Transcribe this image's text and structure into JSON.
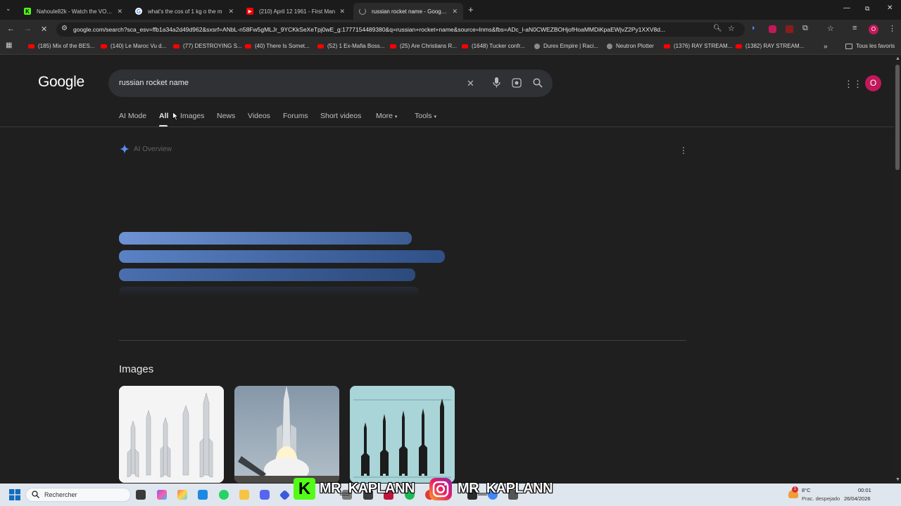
{
  "browser": {
    "tabs": [
      {
        "title": "Nahoule82k - Watch the VOD o",
        "favicon": "kick-icon",
        "color": "#53fc18"
      },
      {
        "title": "what's the cos of 1 kg o the m",
        "favicon": "google-icon",
        "color": "#4285f4"
      },
      {
        "title": "(210) April 12 1961 - First Man",
        "favicon": "youtube-icon",
        "color": "#ff0000"
      },
      {
        "title": "russian rocket name - Google S",
        "favicon": "loading-icon",
        "color": "#9aa0a6",
        "active": true
      }
    ],
    "url": "google.com/search?sca_esv=ffb1a34a2d49d962&sxsrf=ANbL-n58Fw5gMLJr_9YCKkSeXeTpj0wE_g:1777154489380&q=russian+rocket+name&source=lnms&fbs=ADc_l-aN0CWEZBOHjofHoaMMDiKpaEWjvZ2Py1XXV8d...",
    "bookmarks": [
      {
        "label": "(185) Mix of the BES...",
        "type": "yt"
      },
      {
        "label": "(140) Le Maroc Vu d...",
        "type": "yt"
      },
      {
        "label": "(77) DESTROYING S...",
        "type": "yt"
      },
      {
        "label": "(40) There Is Somet...",
        "type": "yt"
      },
      {
        "label": "(52) 1 Ex-Mafia Boss...",
        "type": "yt"
      },
      {
        "label": "(25) Are Christians R...",
        "type": "yt"
      },
      {
        "label": "(1648) Tucker confr...",
        "type": "yt"
      },
      {
        "label": "Durex Empire | Raci...",
        "type": "gray"
      },
      {
        "label": "Neutron Plotter",
        "type": "gray"
      },
      {
        "label": "(1376) RAY STREAM...",
        "type": "yt"
      },
      {
        "label": "(1382) RAY STREAM...",
        "type": "yt"
      }
    ],
    "all_bookmarks": "Tous les favoris",
    "profile_initial": "O"
  },
  "google": {
    "logo": "Google",
    "query": "russian rocket name",
    "tabs": [
      "AI Mode",
      "All",
      "Images",
      "News",
      "Videos",
      "Forums",
      "Short videos",
      "More",
      "Tools"
    ],
    "active_tab": "All",
    "ai_overview": "AI Overview",
    "images_heading": "Images",
    "avatar_initial": "O"
  },
  "taskbar": {
    "search_placeholder": "Rechercher",
    "weather_temp": "8°C",
    "weather_desc": "Prac. despejado",
    "time": "00:01",
    "date": "26/04/2026",
    "notification_badge": "1"
  },
  "overlay": {
    "kick_handle": "MR_KAPLANN",
    "instagram_handle": "MR_KAPLANN"
  },
  "colors": {
    "accent": "#8ab4f8",
    "kick": "#53fc18",
    "avatar": "#c2185b"
  }
}
